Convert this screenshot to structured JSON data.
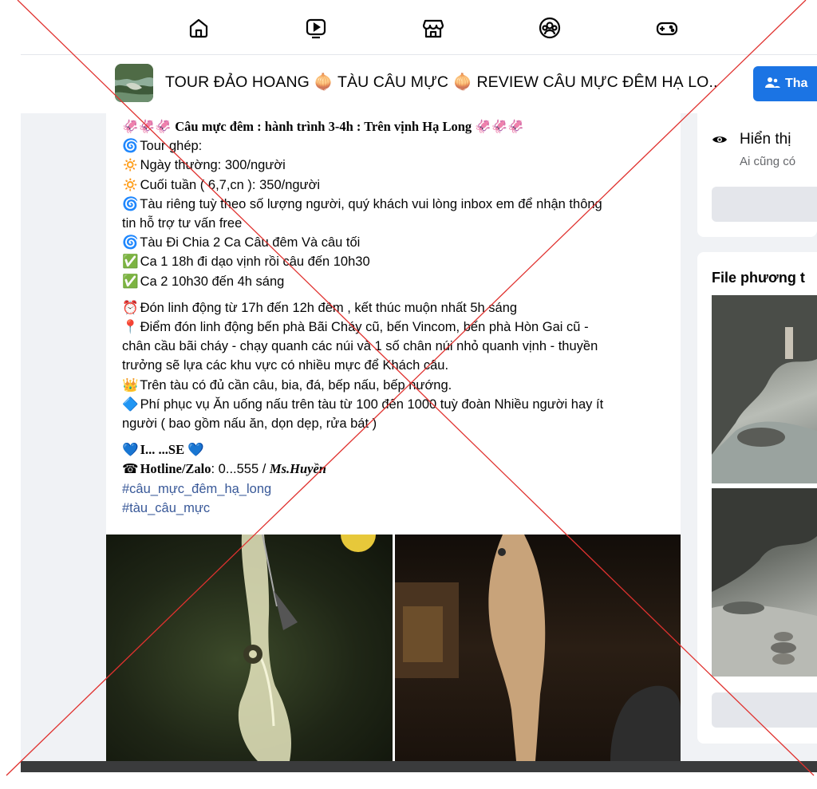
{
  "nav": {
    "icons": [
      "home-icon",
      "watch-icon",
      "marketplace-icon",
      "groups-icon",
      "gaming-icon"
    ]
  },
  "group": {
    "title": "TOUR ĐẢO HOANG 🧅 TÀU CÂU MỰC 🧅 REVIEW CÂU MỰC ĐÊM HẠ LO..",
    "join_label": "Tha"
  },
  "post": {
    "lines": [
      {
        "emoji": "🦑🦑🦑",
        "text": "Câu mực đêm : hành trình 3-4h : Trên vịnh Hạ Long 🦑🦑🦑",
        "style": "serif-b"
      },
      {
        "emoji": "🌀",
        "text": "Tour ghép:"
      },
      {
        "emoji": "🔅",
        "text": "Ngày thường: 300/người"
      },
      {
        "emoji": "🔅",
        "text": "Cuối tuần ( 6,7,cn ): 350/người"
      },
      {
        "emoji": "🌀",
        "text": "Tàu riêng tuỳ theo số lượng người, quý khách vui lòng inbox em để nhận thông"
      },
      {
        "emoji": "",
        "text": "tin hỗ trợ tư vấn free"
      },
      {
        "emoji": "🌀",
        "text": "Tàu Đi Chia 2 Ca Câu đêm Và câu tối"
      },
      {
        "emoji": "✅",
        "text": "Ca 1 18h đi dạo vịnh rồi câu đến 10h30"
      },
      {
        "emoji": "✅",
        "text": "Ca 2 10h30 đến 4h sáng"
      }
    ],
    "lines2": [
      {
        "emoji": "⏰",
        "text": "Đón linh động từ 17h đến 12h đêm , kết thúc muộn nhất 5h sáng"
      },
      {
        "emoji": "📍",
        "text": "Điểm đón linh động bến phà Bãi Cháy cũ, bến Vincom, bến phà Hòn Gai cũ -"
      },
      {
        "emoji": "",
        "text": "chân cầu bãi cháy  - chạy quanh các núi và 1 số chân núi nhỏ quanh vịnh - thuyền"
      },
      {
        "emoji": "",
        "text": "trưởng sẽ lựa các khu vực có  nhiều mực để Khách câu."
      },
      {
        "emoji": "👑",
        "text": "Trên tàu có đủ cần câu, bia, đá, bếp nấu, bếp nướng."
      },
      {
        "emoji": "🔷",
        "text": "Phí phục vụ Ăn uống nấu trên tàu  từ 100 đến 1000 tuỳ đoàn Nhiều người hay ít"
      },
      {
        "emoji": "",
        "text": "người ( bao gồm nấu ăn, dọn dẹp, rửa bát )"
      }
    ],
    "house_line": {
      "emoji": "💙",
      "text": "I... ...SE 💙"
    },
    "hotline_label": "Hotline/Zalo",
    "hotline_value": ": 0...555 / ",
    "hotline_name": "Ms.Huyền",
    "hashtags": [
      "#câu_mực_đêm_hạ_long",
      "#tàu_câu_mực"
    ]
  },
  "sidebar": {
    "visibility_title": "Hiển thị",
    "visibility_sub": "Ai cũng có",
    "files_title": "File phương t"
  },
  "colors": {
    "accent": "#1b74e4",
    "hashtag": "#385898",
    "page_bg": "#f0f2f5",
    "cross": "#e0322f"
  }
}
